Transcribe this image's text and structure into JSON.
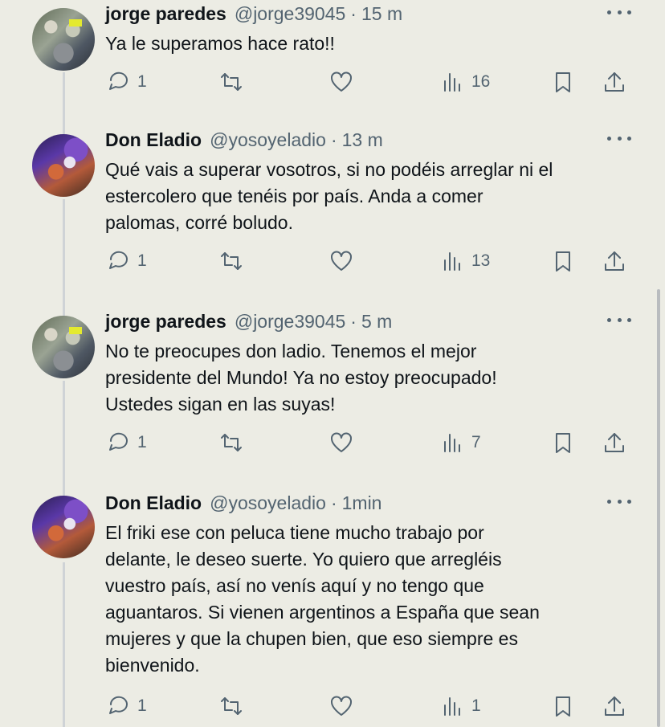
{
  "tweets": [
    {
      "name": "jorge paredes",
      "handle": "@jorge39045",
      "dot": "·",
      "time": "15 m",
      "lines": [
        "Ya le superamos hace rato!!"
      ],
      "replies": "1",
      "views": "16"
    },
    {
      "name": "Don Eladio",
      "handle": "@yosoyeladio",
      "dot": "·",
      "time": "13 m",
      "lines": [
        "Qué vais a superar vosotros, si no podéis arreglar ni el",
        "estercolero que tenéis por país. Anda a comer",
        "palomas, corré boludo."
      ],
      "replies": "1",
      "views": "13"
    },
    {
      "name": "jorge paredes",
      "handle": "@jorge39045",
      "dot": "·",
      "time": "5 m",
      "lines": [
        "No te preocupes don ladio. Tenemos el mejor",
        "presidente del Mundo! Ya no estoy preocupado!",
        "Ustedes sigan en las suyas!"
      ],
      "replies": "1",
      "views": "7"
    },
    {
      "name": "Don Eladio",
      "handle": "@yosoyeladio",
      "dot": "·",
      "time": "1min",
      "lines": [
        "El friki ese con peluca tiene mucho trabajo por",
        "delante, le deseo suerte. Yo quiero que arregléis",
        "vuestro país, así no venís aquí y no tengo que",
        "aguantaros. Si vienen argentinos a España que sean",
        "mujeres y que la chupen bien, que eso siempre es",
        "bienvenido."
      ],
      "replies": "1",
      "views": "1"
    }
  ],
  "icons": {
    "reply": "reply-icon",
    "retweet": "retweet-icon",
    "like": "heart-icon",
    "views": "views-icon",
    "bookmark": "bookmark-icon",
    "share": "share-icon",
    "more": "more-icon"
  },
  "colors": {
    "background": "#ecece4",
    "text": "#0f1419",
    "secondary": "#536471",
    "thread_line": "#cfd3d6"
  }
}
